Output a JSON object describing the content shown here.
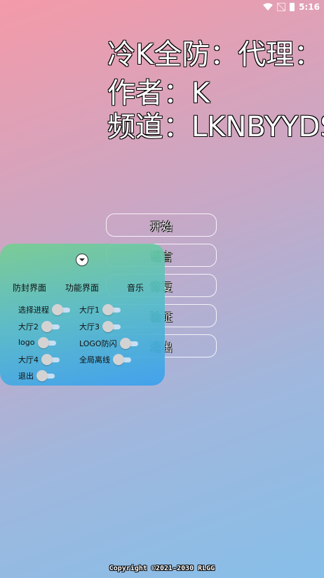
{
  "status_bar": {
    "time": "5:16",
    "icons": [
      "wifi-icon",
      "no-signal-icon",
      "battery-icon"
    ]
  },
  "headlines": [
    "冷K全防：代理：",
    "作者：K",
    "频道：LKNBYYDS"
  ],
  "main_buttons": [
    {
      "lead": "",
      "rest": "开始"
    },
    {
      "lead": "语",
      "rest": "言"
    },
    {
      "lead": "修",
      "rest": "复"
    },
    {
      "lead": "验",
      "rest": "证"
    },
    {
      "lead": "退",
      "rest": "出"
    }
  ],
  "panel": {
    "tabs": [
      "防封界面",
      "功能界面",
      "音乐"
    ],
    "toggles": [
      {
        "label": "选择进程",
        "on": false
      },
      {
        "label": "大厅1",
        "on": false
      },
      {
        "label": "大厅2",
        "on": false
      },
      {
        "label": "大厅3",
        "on": false
      },
      {
        "label": "logo",
        "on": false
      },
      {
        "label": "LOGO防闪",
        "on": false
      },
      {
        "label": "大厅4",
        "on": false
      },
      {
        "label": "全局离线",
        "on": false
      },
      {
        "label": "退出",
        "on": false
      }
    ]
  },
  "footer": {
    "copyright": "Copyright ©2021-2030 RLGG"
  },
  "colors": {
    "accent_green": "#2fd08a",
    "panel_top": "#76ce92",
    "panel_bottom": "#3ea0ee"
  }
}
